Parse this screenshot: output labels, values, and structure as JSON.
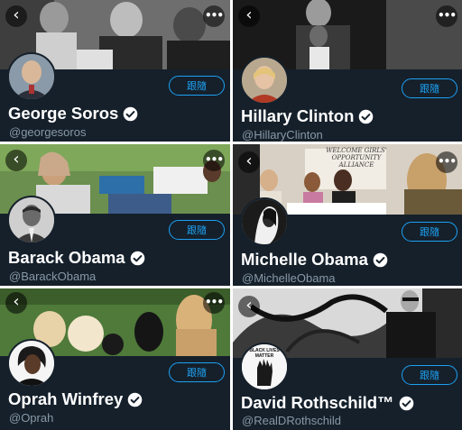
{
  "colors": {
    "card_bg": "#15202b",
    "accent": "#1da1f2",
    "handle": "#8899a6",
    "name": "#ffffff"
  },
  "icons": {
    "back": "back-arrow-icon",
    "more": "more-options-icon",
    "verified": "verified-badge-icon"
  },
  "profiles": [
    {
      "name": "George Soros",
      "handle": "@georgesoros",
      "follow_label": "跟隨",
      "back_glyph": "‹",
      "more_glyph": "•••"
    },
    {
      "name": "Hillary Clinton",
      "handle": "@HillaryClinton",
      "follow_label": "跟隨",
      "back_glyph": "‹",
      "more_glyph": "•••"
    },
    {
      "name": "Barack Obama",
      "handle": "@BarackObama",
      "follow_label": "跟隨",
      "back_glyph": "‹",
      "more_glyph": "•••"
    },
    {
      "name": "Michelle Obama",
      "handle": "@MichelleObama",
      "follow_label": "跟隨",
      "back_glyph": "‹",
      "more_glyph": "•••",
      "banner_sign": "WELCOME GIRLS' OPPORTUNITY ALLIANCE"
    },
    {
      "name": "Oprah Winfrey",
      "handle": "@Oprah",
      "follow_label": "跟隨",
      "back_glyph": "‹",
      "more_glyph": "•••"
    },
    {
      "name": "David Rothschild™",
      "handle": "@RealDRothschild",
      "follow_label": "跟隨",
      "back_glyph": "‹",
      "more_glyph": "•••",
      "avatar_text": "BLACK LIVES MATTER"
    }
  ]
}
